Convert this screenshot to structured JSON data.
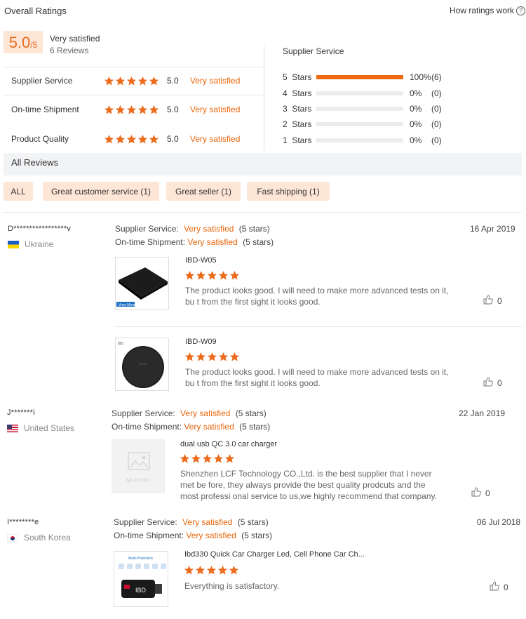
{
  "header": {
    "title": "Overall Ratings",
    "how_link": "How ratings work",
    "help_icon": "question-circle-icon"
  },
  "summary": {
    "score": "5.0",
    "score_suffix": "/5",
    "label": "Very satisfied",
    "reviews": "6 Reviews"
  },
  "categories": [
    {
      "label": "Supplier Service",
      "score": "5.0",
      "desc": "Very satisfied",
      "stars": 5
    },
    {
      "label": "On-time Shipment",
      "score": "5.0",
      "desc": "Very satisfied",
      "stars": 5
    },
    {
      "label": "Product Quality",
      "score": "5.0",
      "desc": "Very satisfied",
      "stars": 5
    }
  ],
  "distribution": {
    "title": "Supplier Service",
    "rows": [
      {
        "label": "5  Stars",
        "fraction": 1.0,
        "pct": "100%",
        "count": "(6)"
      },
      {
        "label": "4  Stars",
        "fraction": 0.0,
        "pct": "0%",
        "count": "(0)"
      },
      {
        "label": "3  Stars",
        "fraction": 0.0,
        "pct": "0%",
        "count": "(0)"
      },
      {
        "label": "2  Stars",
        "fraction": 0.0,
        "pct": "0%",
        "count": "(0)"
      },
      {
        "label": "1  Stars",
        "fraction": 0.0,
        "pct": "0%",
        "count": "(0)"
      }
    ]
  },
  "all_reviews": "All Reviews",
  "filters": [
    "ALL",
    "Great customer service (1)",
    "Great seller (1)",
    "Fast shipping (1)"
  ],
  "reviews": [
    {
      "name": "D*****************v",
      "country": "Ukraine",
      "date": "16 Apr 2019",
      "service_label": "Supplier Service:",
      "service_value": "Very satisfied",
      "service_stars": "(5 stars)",
      "shipment_label": "On-time Shipment:",
      "shipment_value": "Very satisfied",
      "shipment_stars": "(5 stars)",
      "products": [
        {
          "title": "IBD-W05",
          "text": "The product looks good. I will need to make more advanced tests on it, bu t from the first sight it looks good.",
          "likes": "0",
          "thumb_label": "View More"
        },
        {
          "title": "IBD-W09",
          "text": "The product looks good. I will need to make more advanced tests on it, bu t from the first sight it looks good.",
          "likes": "0",
          "thumb_label": "IBD"
        }
      ]
    },
    {
      "name": "J*******i",
      "country": "United States",
      "date": "22 Jan 2019",
      "service_label": "Supplier Service:",
      "service_value": "Very satisfied",
      "service_stars": "(5 stars)",
      "shipment_label": "On-time Shipment:",
      "shipment_value": "Very satisfied",
      "shipment_stars": "(5 stars)",
      "products": [
        {
          "title": "dual usb QC 3.0 car charger",
          "text": "Shenzhen LCF Technology CO.,Ltd. is the best supplier that I never met be fore, they always provide the best quality prodcuts and the most professi onal service to us,we highly recommend that company.",
          "likes": "0",
          "thumb_label": "No Photo"
        }
      ]
    },
    {
      "name": "I********e",
      "country": "South Korea",
      "date": "06 Jul 2018",
      "service_label": "Supplier Service:",
      "service_value": "Very satisfied",
      "service_stars": "(5 stars)",
      "shipment_label": "On-time Shipment:",
      "shipment_value": "Very satisfied",
      "shipment_stars": "(5 stars)",
      "products": [
        {
          "title": "Ibd330 Quick Car Charger Led, Cell Phone Car Ch...",
          "text": "Everything is satisfactory.",
          "likes": "0",
          "thumb_label": "Multi-Protection",
          "thumb_brand": "IBD"
        }
      ]
    }
  ],
  "colors": {
    "accent": "#e8650a",
    "star": "#ec6b1c",
    "chip_bg": "#fde6d6"
  }
}
